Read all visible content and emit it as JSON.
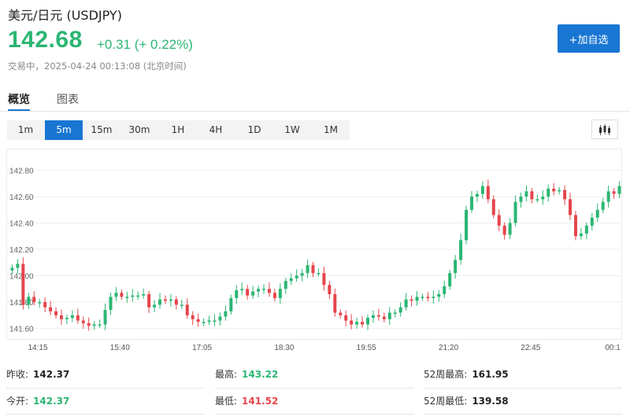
{
  "header": {
    "title": "美元/日元 (USDJPY)",
    "price": "142.68",
    "change": "+0.31 (+ 0.22%)",
    "status": "交易中，2025-04-24 00:13:08 (北京时间)",
    "watch_button": "+加自选"
  },
  "tabs": [
    {
      "label": "概览",
      "active": true
    },
    {
      "label": "图表",
      "active": false
    }
  ],
  "periods": [
    {
      "label": "1m",
      "active": false
    },
    {
      "label": "5m",
      "active": true
    },
    {
      "label": "15m",
      "active": false
    },
    {
      "label": "30m",
      "active": false
    },
    {
      "label": "1H",
      "active": false
    },
    {
      "label": "4H",
      "active": false
    },
    {
      "label": "1D",
      "active": false
    },
    {
      "label": "1W",
      "active": false
    },
    {
      "label": "1M",
      "active": false
    }
  ],
  "icons": {
    "chart_type": "candlestick-icon"
  },
  "colors": {
    "up": "#2bb673",
    "down": "#e5454c",
    "accent": "#1976d2"
  },
  "stats": {
    "prev_close_label": "昨收:",
    "prev_close": "142.37",
    "open_label": "今开:",
    "open": "142.37",
    "high_label": "最高:",
    "high": "143.22",
    "low_label": "最低:",
    "low": "141.52",
    "high52_label": "52周最高:",
    "high52": "161.95",
    "low52_label": "52周最低:",
    "low52": "139.58"
  },
  "chart_data": {
    "type": "candlestick",
    "interval": "5m",
    "y_ticks": [
      "142.80",
      "142.60",
      "142.40",
      "142.20",
      "142.00",
      "141.80",
      "141.60"
    ],
    "x_ticks": [
      "14:15",
      "15:40",
      "17:05",
      "18:30",
      "19:55",
      "21:20",
      "22:45",
      "00:1"
    ],
    "ylim": [
      141.52,
      142.94
    ],
    "grid": true,
    "close_series": [
      142.06,
      142.09,
      141.78,
      141.84,
      141.8,
      141.8,
      141.76,
      141.73,
      141.7,
      141.67,
      141.68,
      141.7,
      141.66,
      141.64,
      141.62,
      141.63,
      141.63,
      141.74,
      141.84,
      141.87,
      141.84,
      141.84,
      141.85,
      141.85,
      141.86,
      141.76,
      141.78,
      141.82,
      141.81,
      141.82,
      141.78,
      141.78,
      141.7,
      141.67,
      141.65,
      141.65,
      141.66,
      141.66,
      141.69,
      141.73,
      141.83,
      141.89,
      141.9,
      141.85,
      141.88,
      141.9,
      141.9,
      141.87,
      141.83,
      141.9,
      141.96,
      141.98,
      142,
      142.02,
      142.08,
      142.02,
      142.02,
      141.93,
      141.86,
      141.72,
      141.7,
      141.66,
      141.63,
      141.65,
      141.63,
      141.68,
      141.7,
      141.69,
      141.67,
      141.72,
      141.72,
      141.76,
      141.82,
      141.81,
      141.84,
      141.84,
      141.83,
      141.84,
      141.86,
      141.92,
      142.02,
      142.12,
      142.27,
      142.5,
      142.6,
      142.62,
      142.68,
      142.58,
      142.46,
      142.38,
      142.31,
      142.4,
      142.56,
      142.6,
      142.64,
      142.58,
      142.58,
      142.6,
      142.66,
      142.64,
      142.65,
      142.58,
      142.46,
      142.3,
      142.32,
      142.38,
      142.44,
      142.5,
      142.56,
      142.64,
      142.62,
      142.68
    ]
  }
}
